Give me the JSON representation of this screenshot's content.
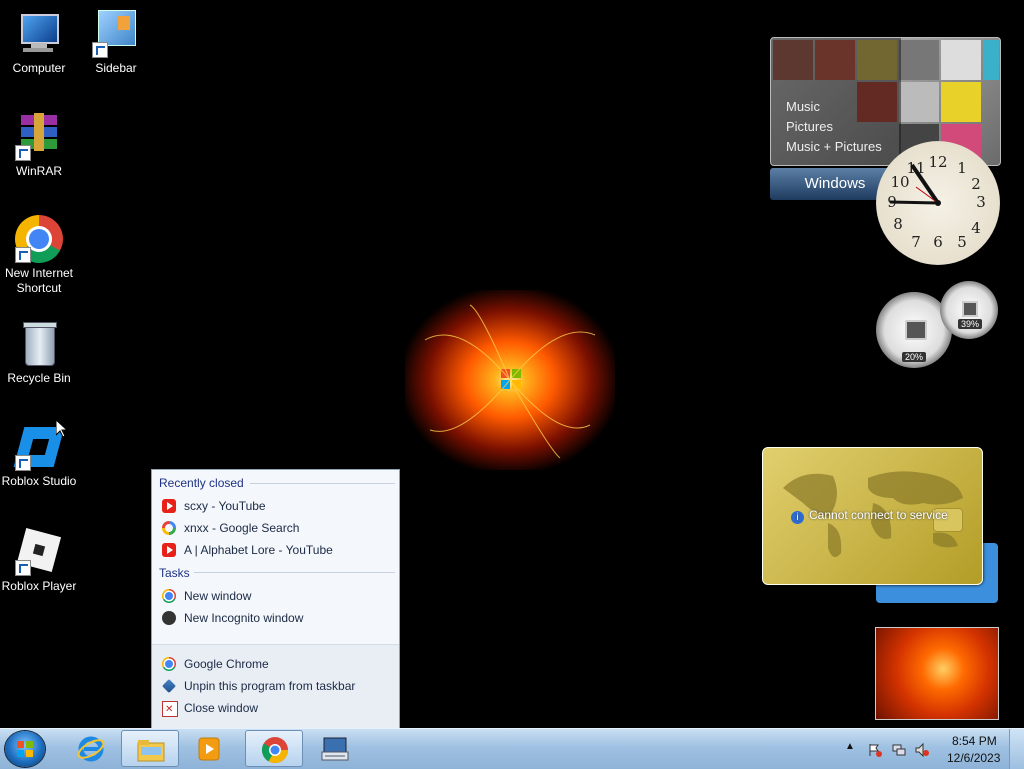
{
  "desktop": {
    "icons": [
      {
        "label": "Computer"
      },
      {
        "label": "Sidebar"
      },
      {
        "label": "WinRAR"
      },
      {
        "label": "New Internet Shortcut"
      },
      {
        "label": "Recycle Bin"
      },
      {
        "label": "Roblox Studio"
      },
      {
        "label": "Roblox Player"
      }
    ]
  },
  "gadgets": {
    "media_center": {
      "items": [
        "Music",
        "Pictures",
        "Music + Pictures"
      ],
      "bar_label": "Windows"
    },
    "clock": {
      "numbers": [
        "12",
        "1",
        "2",
        "3",
        "4",
        "5",
        "6",
        "7",
        "8",
        "9",
        "10",
        "11"
      ]
    },
    "cpu_meter": {
      "cpu_percent": "20%",
      "memory_percent": "39%"
    },
    "currency_card": {
      "message": "Cannot connect to service"
    }
  },
  "jumplist": {
    "recently_closed_header": "Recently closed",
    "recent": [
      {
        "label": "scxy - YouTube",
        "icon": "youtube-icon"
      },
      {
        "label": "xnxx - Google Search",
        "icon": "google-icon"
      },
      {
        "label": "A | Alphabet Lore - YouTube",
        "icon": "youtube-icon"
      }
    ],
    "tasks_header": "Tasks",
    "tasks": [
      {
        "label": "New window",
        "icon": "chrome-icon"
      },
      {
        "label": "New Incognito window",
        "icon": "incognito-icon"
      }
    ],
    "actions": [
      {
        "label": "Google Chrome",
        "icon": "chrome-icon"
      },
      {
        "label": "Unpin this program from taskbar",
        "icon": "unpin-icon"
      },
      {
        "label": "Close window",
        "icon": "close-icon"
      }
    ]
  },
  "taskbar": {
    "time": "8:54 PM",
    "date": "12/6/2023",
    "pinned": [
      "internet-explorer-icon",
      "file-explorer-icon",
      "media-player-icon",
      "chrome-icon",
      "on-screen-keyboard-icon"
    ]
  },
  "colors": {
    "taskbar": "#9fc1e2",
    "jumplist_header": "#1e3287",
    "accent": "#1a5fb4"
  }
}
